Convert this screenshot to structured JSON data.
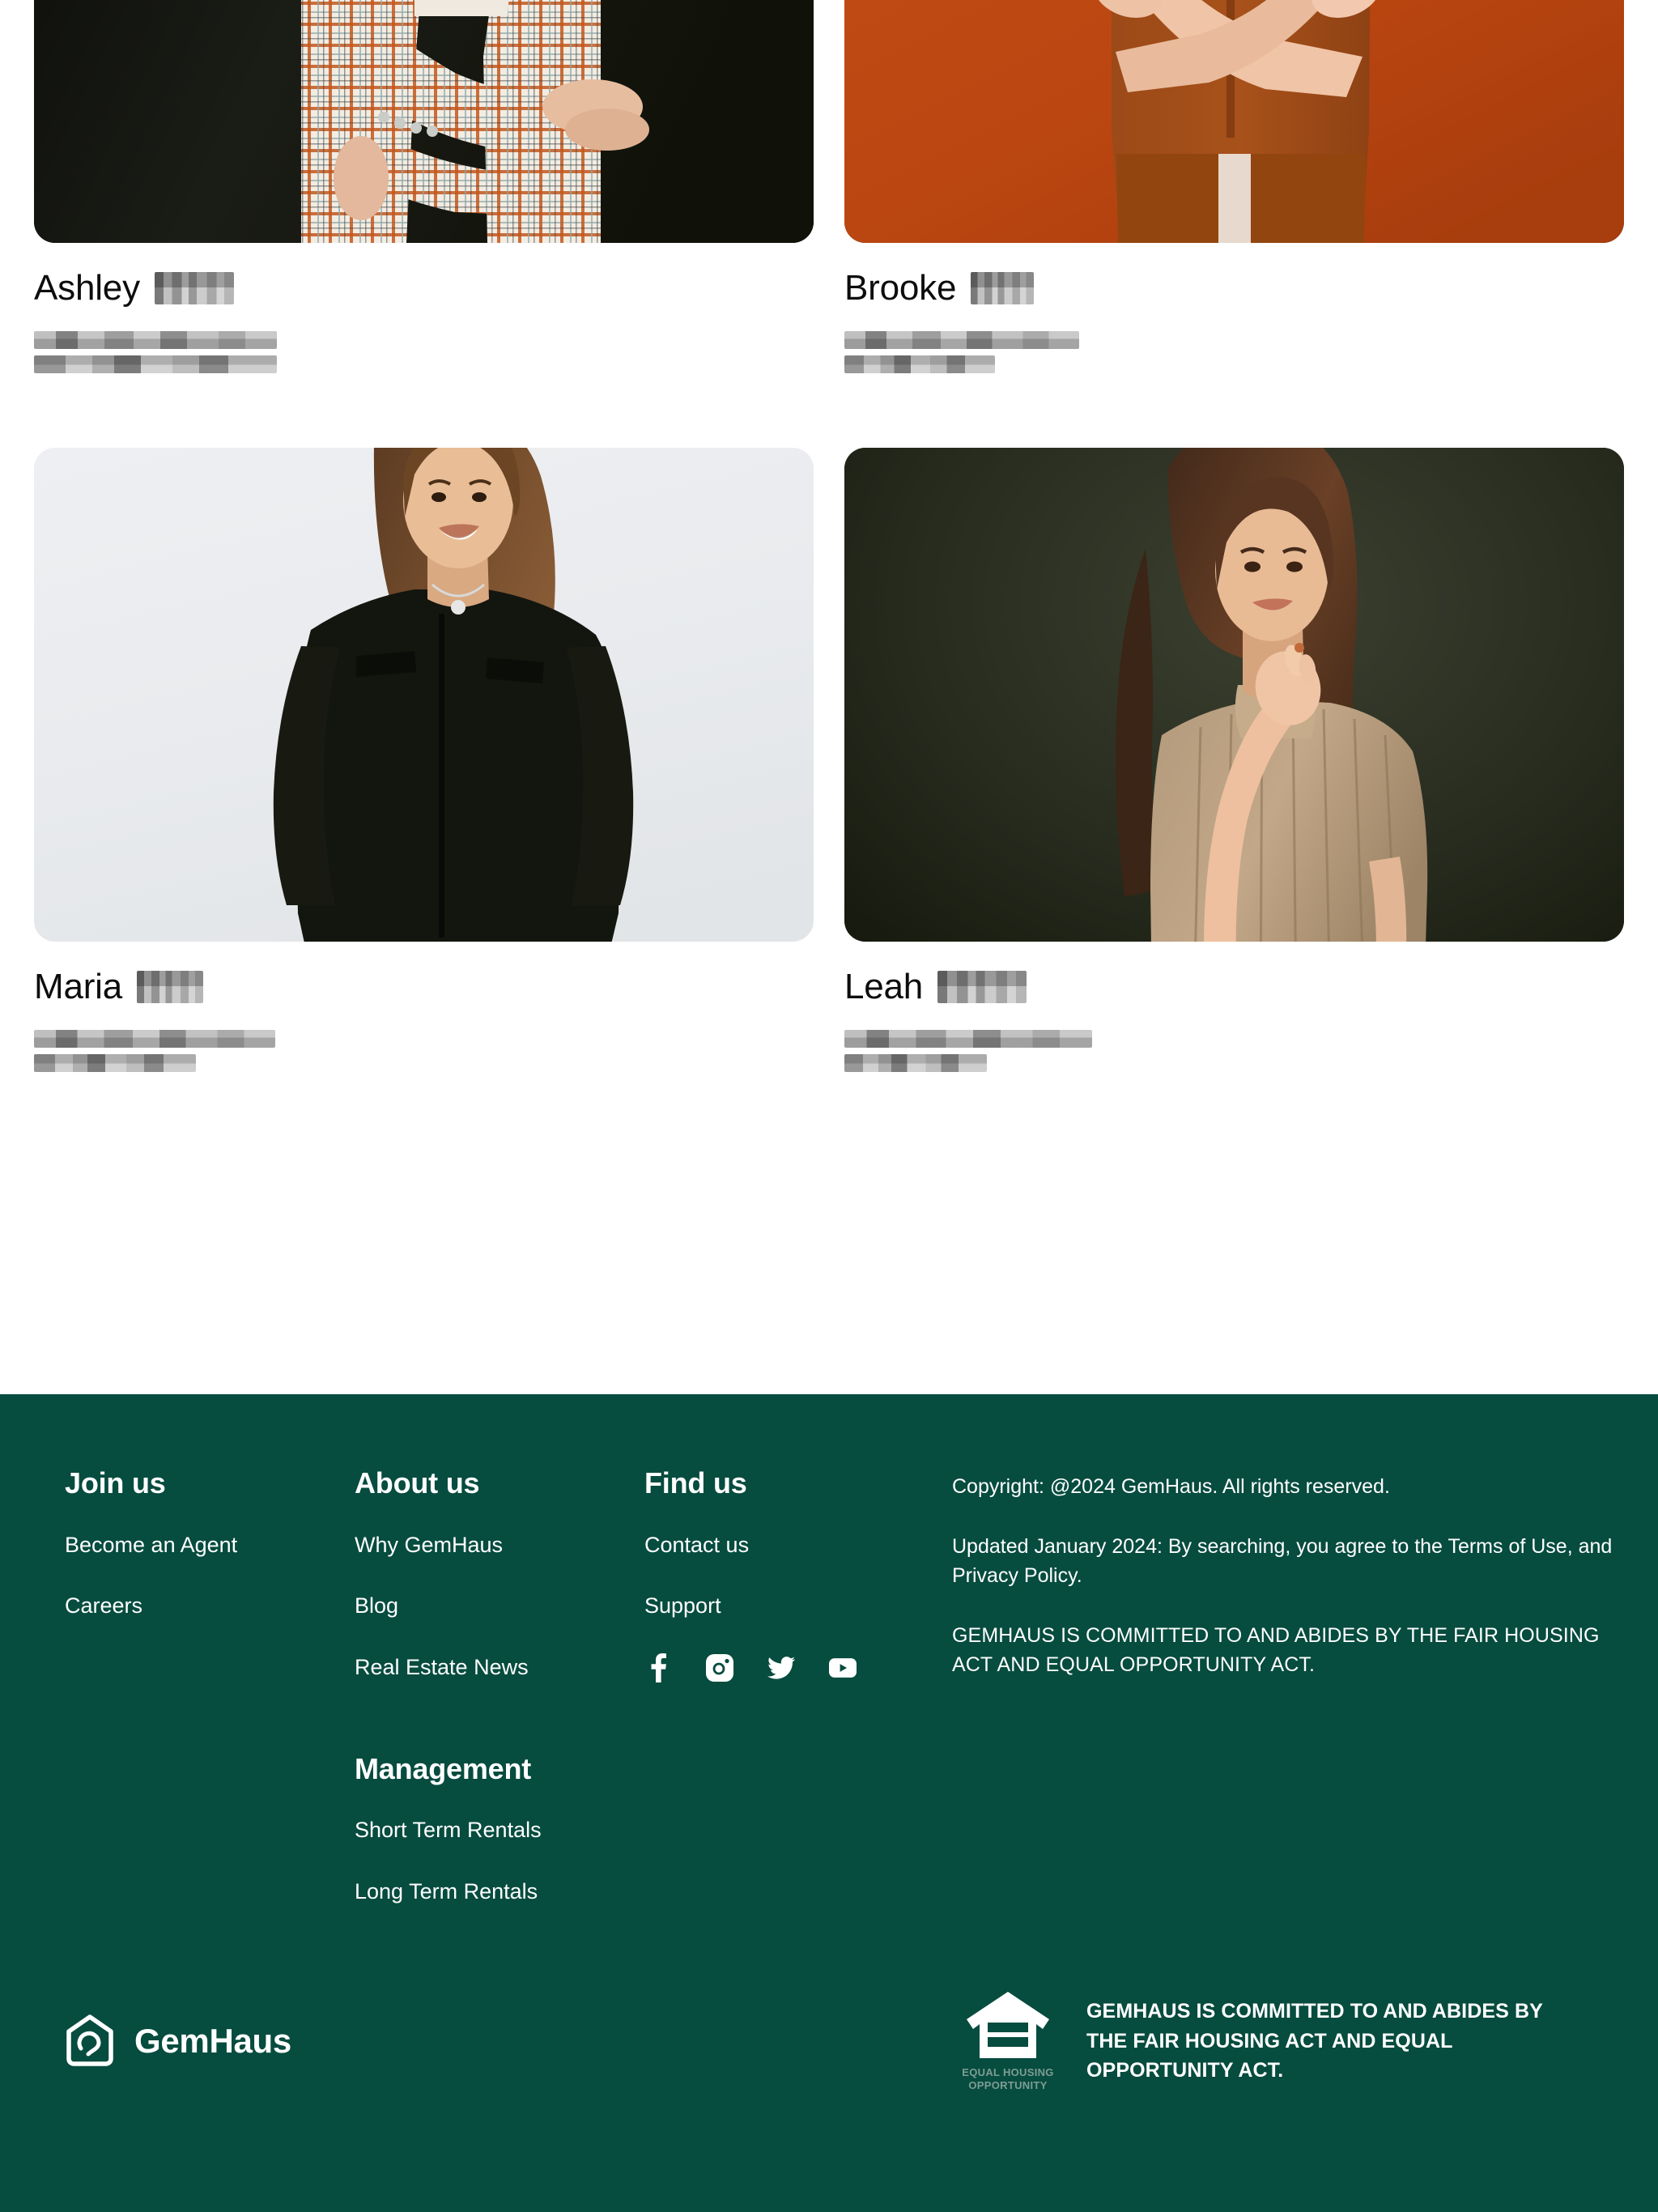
{
  "colors": {
    "footer_green": "#064C3F",
    "accent_orange": "#C04A14",
    "text_dark": "#0d0d0d",
    "eho_caption": "#7e9d94"
  },
  "agents": [
    {
      "first_name": "Ashley",
      "last_name_redacted": true,
      "photo_style": "dark-studio-plaid-blazer",
      "details_redacted": true,
      "detail_lines": 2
    },
    {
      "first_name": "Brooke",
      "last_name_redacted": true,
      "photo_style": "orange-background-rust-cardigan",
      "details_redacted": true,
      "detail_lines": 2
    },
    {
      "first_name": "Maria",
      "last_name_redacted": true,
      "photo_style": "light-gray-background-black-blouse",
      "details_redacted": true,
      "detail_lines": 2
    },
    {
      "first_name": "Leah",
      "last_name_redacted": true,
      "photo_style": "dark-olive-background-tan-top",
      "details_redacted": true,
      "detail_lines": 2
    }
  ],
  "footer": {
    "columns": {
      "join": {
        "heading": "Join us",
        "links": [
          "Become an Agent",
          "Careers"
        ]
      },
      "about": {
        "heading": "About us",
        "links": [
          "Why GemHaus",
          "Blog",
          "Real Estate News"
        ],
        "management_heading": "Management",
        "management_links": [
          "Short Term Rentals",
          "Long Term Rentals"
        ]
      },
      "find": {
        "heading": "Find us",
        "links": [
          "Contact us",
          "Support"
        ],
        "social": [
          {
            "name": "facebook-icon",
            "label": "Facebook"
          },
          {
            "name": "instagram-icon",
            "label": "Instagram"
          },
          {
            "name": "twitter-icon",
            "label": "Twitter"
          },
          {
            "name": "youtube-icon",
            "label": "YouTube"
          }
        ]
      }
    },
    "legal": {
      "copyright": "Copyright: @2024 GemHaus. All rights reserved.",
      "updated": "Updated January 2024: By searching, you agree to the Terms of Use, and Privacy Policy.",
      "fair_housing": "GEMHAUS IS COMMITTED TO AND ABIDES BY THE FAIR HOUSING ACT AND EQUAL OPPORTUNITY ACT."
    },
    "brand": {
      "name": "GemHaus",
      "logo_icon": "gemhaus-house-logo"
    },
    "equal_housing": {
      "logo_icon": "equal-housing-opportunity-icon",
      "caption_line1": "EQUAL HOUSING",
      "caption_line2": "OPPORTUNITY",
      "statement": "GEMHAUS IS COMMITTED TO AND ABIDES BY THE FAIR HOUSING ACT AND EQUAL OPPORTUNITY ACT."
    }
  }
}
